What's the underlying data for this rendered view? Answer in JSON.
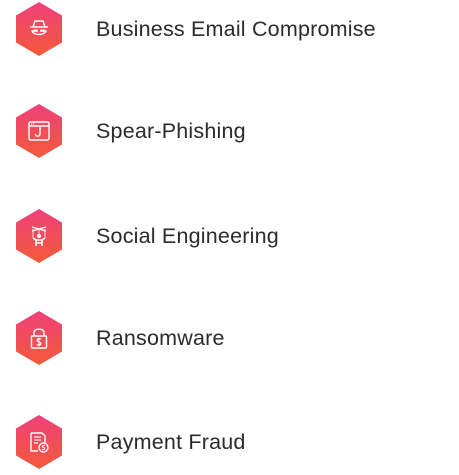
{
  "colors": {
    "hex_top": "#f0407a",
    "hex_bottom": "#f25a3a",
    "text": "#2b2b2b",
    "glyph": "#ffffff"
  },
  "threats": [
    {
      "label": "Business Email Compromise",
      "icon": "spy-icon"
    },
    {
      "label": "Spear-Phishing",
      "icon": "phishing-hook-icon"
    },
    {
      "label": "Social Engineering",
      "icon": "puppet-icon"
    },
    {
      "label": "Ransomware",
      "icon": "locked-dollar-icon"
    },
    {
      "label": "Payment Fraud",
      "icon": "invoice-fraud-icon"
    }
  ]
}
